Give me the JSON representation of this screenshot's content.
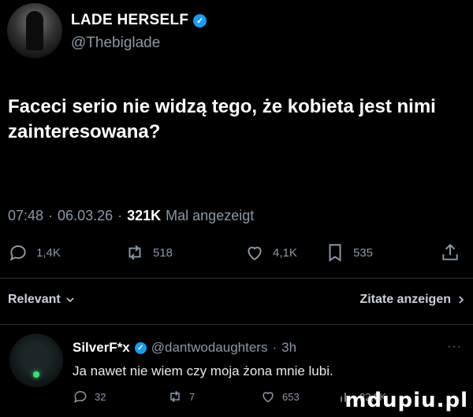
{
  "author": {
    "name": "LADE HERSELF",
    "handle": "@Thebiglade"
  },
  "tweet": {
    "text": "Faceci serio nie widzą tego, że kobieta jest nimi zainteresowana?",
    "time": "07:48",
    "date": "06.03.26",
    "views_count": "321K",
    "views_label": "Mal angezeigt"
  },
  "actions": {
    "replies": "1,4K",
    "reposts": "518",
    "likes": "4,1K",
    "bookmarks": "535"
  },
  "sort": {
    "label": "Relevant",
    "quotes_label": "Zitate anzeigen"
  },
  "reply": {
    "name": "SilverF*x",
    "handle": "@dantwodaughters",
    "time": "3h",
    "text": "Ja nawet nie wiem czy moja żona mnie lubi.",
    "replies": "32",
    "reposts": "7",
    "likes": "653",
    "views": "22,8K",
    "more": "···"
  },
  "watermark": "mdupiu.pl",
  "colors": {
    "background": "#000000",
    "verified": "#1d9bf0",
    "muted": "#8b98a5"
  }
}
